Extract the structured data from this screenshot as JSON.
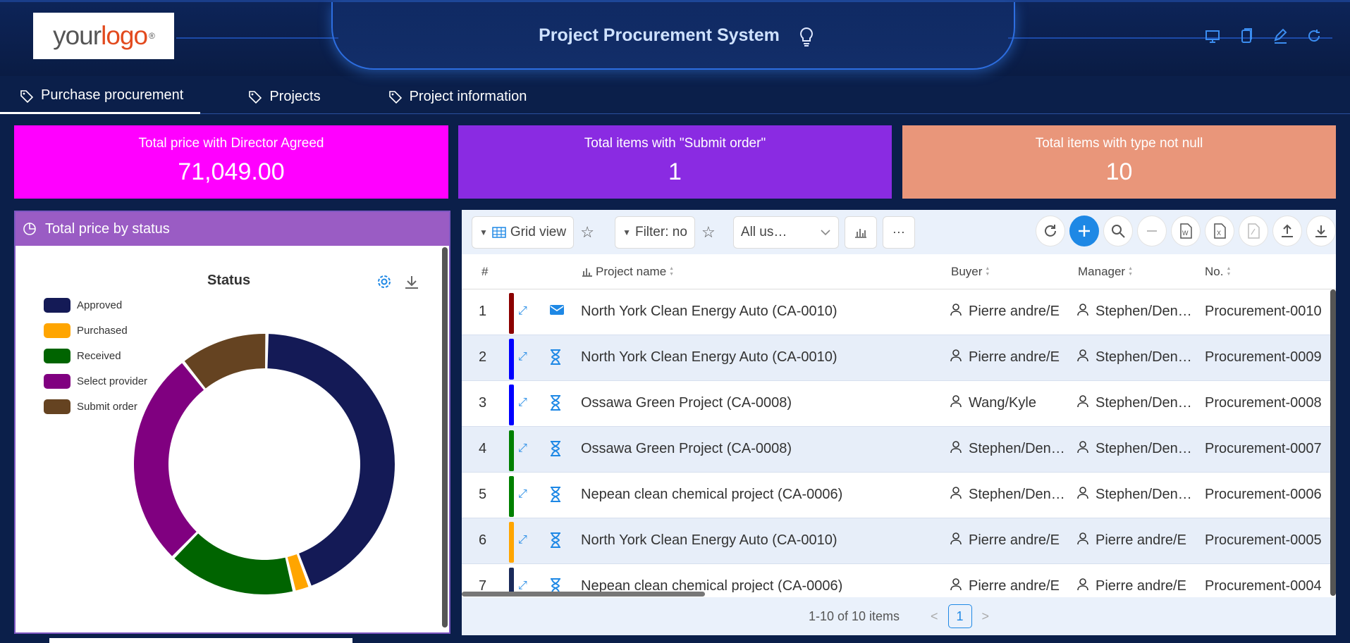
{
  "header": {
    "logo_text_1": "your",
    "logo_text_2": "logo",
    "logo_reg": "®",
    "title": "Project Procurement System"
  },
  "tabs": [
    {
      "label": "Purchase procurement",
      "active": true
    },
    {
      "label": "Projects",
      "active": false
    },
    {
      "label": "Project information",
      "active": false
    }
  ],
  "kpis": [
    {
      "label": "Total price with Director Agreed",
      "value": "71,049.00",
      "color": "#ff00ff"
    },
    {
      "label": "Total items with \"Submit order\"",
      "value": "1",
      "color": "#8a2be2"
    },
    {
      "label": "Total items with type not null",
      "value": "10",
      "color": "#e9967a"
    }
  ],
  "chart_panel": {
    "header": "Total price by status"
  },
  "chart_data": {
    "type": "pie",
    "title": "Status",
    "legend_position": "top-left",
    "categories": [
      "Approved",
      "Purchased",
      "Received",
      "Select provider",
      "Submit order"
    ],
    "colors": [
      "#141a56",
      "#ffa500",
      "#006400",
      "#800080",
      "#654321"
    ],
    "values": [
      44,
      2,
      16,
      27,
      11
    ]
  },
  "toolbar": {
    "grid_view": "Grid view",
    "filter": "Filter: no",
    "users": "All us…"
  },
  "columns": {
    "num": "#",
    "project_name": "Project name",
    "buyer": "Buyer",
    "manager": "Manager",
    "no": "No."
  },
  "rows": [
    {
      "num": "1",
      "bar": "#8b0000",
      "status": "mail",
      "project": "North York Clean Energy Auto (CA-0010)",
      "buyer": "Pierre andre/E",
      "manager": "Stephen/Den…",
      "no": "Procurement-0010"
    },
    {
      "num": "2",
      "bar": "#0000ff",
      "status": "hourglass",
      "project": "North York Clean Energy Auto (CA-0010)",
      "buyer": "Pierre andre/E",
      "manager": "Stephen/Den…",
      "no": "Procurement-0009"
    },
    {
      "num": "3",
      "bar": "#0000ff",
      "status": "hourglass",
      "project": "Ossawa Green Project (CA-0008)",
      "buyer": "Wang/Kyle",
      "manager": "Stephen/Den…",
      "no": "Procurement-0008"
    },
    {
      "num": "4",
      "bar": "#008000",
      "status": "hourglass",
      "project": "Ossawa Green Project (CA-0008)",
      "buyer": "Stephen/Den…",
      "manager": "Stephen/Den…",
      "no": "Procurement-0007"
    },
    {
      "num": "5",
      "bar": "#008000",
      "status": "hourglass",
      "project": "Nepean clean chemical project (CA-0006)",
      "buyer": "Stephen/Den…",
      "manager": "Stephen/Den…",
      "no": "Procurement-0006"
    },
    {
      "num": "6",
      "bar": "#ffa500",
      "status": "hourglass",
      "project": "North York Clean Energy Auto (CA-0010)",
      "buyer": "Pierre andre/E",
      "manager": "Pierre andre/E",
      "no": "Procurement-0005"
    },
    {
      "num": "7",
      "bar": "#1a2a5a",
      "status": "hourglass",
      "project": "Nepean clean chemical project (CA-0006)",
      "buyer": "Pierre andre/E",
      "manager": "Pierre andre/E",
      "no": "Procurement-0004"
    }
  ],
  "footer": {
    "summary": "1-10 of 10 items",
    "page": "1"
  }
}
